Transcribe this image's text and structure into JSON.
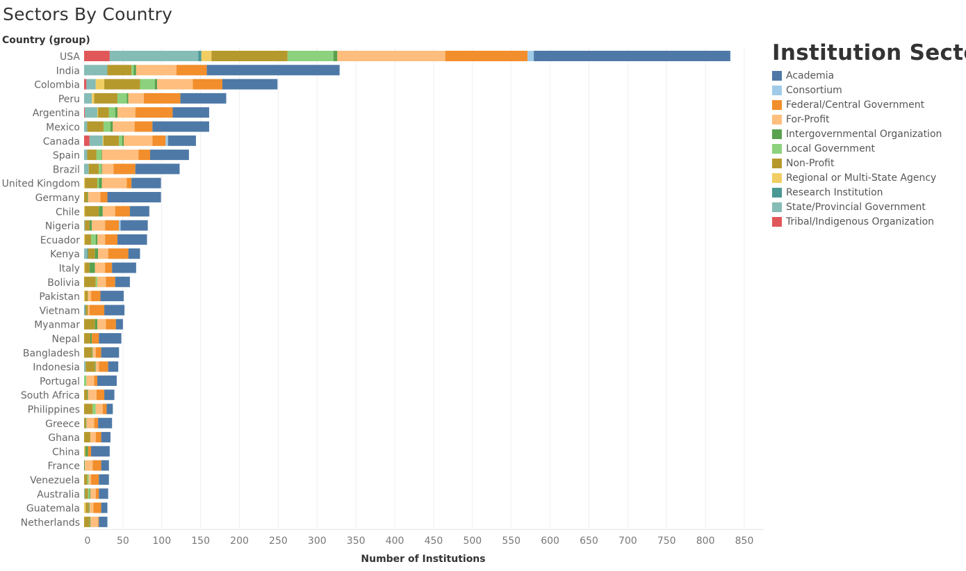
{
  "chart_data": {
    "type": "bar",
    "orientation": "horizontal",
    "stacked": true,
    "title": "Sectors By Country",
    "row_header": "Country (group)",
    "xlabel": "Number of Institutions",
    "ylabel": "Country (group)",
    "xlim": [
      0,
      875
    ],
    "xticks": [
      0,
      50,
      100,
      150,
      200,
      250,
      300,
      350,
      400,
      450,
      500,
      550,
      600,
      650,
      700,
      750,
      800,
      850
    ],
    "grid": true,
    "legend": {
      "title": "Institution Sector",
      "position": "right"
    },
    "stack_order": [
      "Tribal/Indigenous Organization",
      "State/Provincial Government",
      "Research Institution",
      "Regional or Multi-State Agency",
      "Non-Profit",
      "Local Government",
      "Intergovernmental Organization",
      "For-Profit",
      "Federal/Central Government",
      "Consortium",
      "Academia"
    ],
    "categories": [
      "USA",
      "India",
      "Colombia",
      "Peru",
      "Argentina",
      "Mexico",
      "Canada",
      "Spain",
      "Brazil",
      "United Kingdom",
      "Germany",
      "Chile",
      "Nigeria",
      "Ecuador",
      "Kenya",
      "Italy",
      "Bolivia",
      "Pakistan",
      "Vietnam",
      "Myanmar",
      "Nepal",
      "Bangladesh",
      "Indonesia",
      "Portugal",
      "South Africa",
      "Philippines",
      "Greece",
      "Ghana",
      "China",
      "France",
      "Venezuela",
      "Australia",
      "Guatemala",
      "Netherlands"
    ],
    "series": [
      {
        "name": "Academia",
        "color": "#4e79a7",
        "values": [
          253,
          171,
          71,
          59,
          47,
          73,
          36,
          50,
          57,
          38,
          69,
          25,
          35,
          38,
          15,
          31,
          19,
          30,
          26,
          9,
          29,
          23,
          13,
          25,
          13,
          8,
          18,
          12,
          24,
          10,
          13,
          12,
          8,
          11
        ]
      },
      {
        "name": "Consortium",
        "color": "#a0cbe8",
        "values": [
          8,
          0,
          0,
          0,
          0,
          0,
          3,
          0,
          0,
          0,
          0,
          0,
          2,
          0,
          0,
          0,
          0,
          0,
          0,
          0,
          0,
          0,
          0,
          0,
          0,
          0,
          0,
          0,
          0,
          0,
          0,
          0,
          0,
          0
        ]
      },
      {
        "name": "Federal/Central Government",
        "color": "#f28e2b",
        "values": [
          106,
          39,
          38,
          47,
          48,
          23,
          17,
          15,
          28,
          6,
          9,
          19,
          18,
          16,
          26,
          9,
          12,
          12,
          19,
          13,
          9,
          7,
          12,
          4,
          10,
          5,
          5,
          7,
          4,
          11,
          10,
          4,
          10,
          1
        ]
      },
      {
        "name": "For-Profit",
        "color": "#ffbe7d",
        "values": [
          139,
          52,
          46,
          20,
          23,
          28,
          37,
          47,
          15,
          32,
          16,
          16,
          17,
          10,
          13,
          13,
          11,
          4,
          2,
          11,
          0,
          4,
          4,
          10,
          11,
          9,
          10,
          7,
          0,
          10,
          3,
          7,
          5,
          10
        ]
      },
      {
        "name": "Intergovernmental Organization",
        "color": "#59a14f",
        "values": [
          5,
          3,
          3,
          2,
          3,
          3,
          2,
          1,
          1,
          4,
          1,
          5,
          3,
          2,
          4,
          7,
          0,
          0,
          0,
          3,
          2,
          1,
          1,
          0,
          1,
          0,
          1,
          0,
          3,
          1,
          0,
          1,
          1,
          1
        ]
      },
      {
        "name": "Local Government",
        "color": "#8cd17d",
        "values": [
          59,
          3,
          19,
          12,
          8,
          9,
          4,
          6,
          3,
          2,
          0,
          0,
          0,
          6,
          0,
          0,
          2,
          0,
          0,
          0,
          0,
          0,
          0,
          3,
          0,
          4,
          0,
          0,
          0,
          0,
          2,
          2,
          0,
          0
        ]
      },
      {
        "name": "Non-Profit",
        "color": "#b6992d",
        "values": [
          98,
          31,
          46,
          30,
          14,
          21,
          20,
          12,
          13,
          16,
          4,
          18,
          6,
          8,
          9,
          6,
          15,
          4,
          3,
          14,
          8,
          10,
          12,
          0,
          4,
          11,
          2,
          8,
          1,
          0,
          4,
          4,
          4,
          7
        ]
      },
      {
        "name": "Regional or Multi-State Agency",
        "color": "#f1ce63",
        "values": [
          13,
          0,
          11,
          3,
          1,
          0,
          1,
          0,
          0,
          1,
          0,
          1,
          0,
          1,
          0,
          1,
          0,
          1,
          0,
          0,
          0,
          0,
          0,
          0,
          0,
          0,
          0,
          0,
          1,
          0,
          0,
          0,
          2,
          0
        ]
      },
      {
        "name": "Research Institution",
        "color": "#499894",
        "values": [
          4,
          0,
          0,
          0,
          0,
          0,
          0,
          0,
          0,
          0,
          0,
          0,
          0,
          0,
          1,
          0,
          0,
          0,
          1,
          0,
          0,
          0,
          0,
          0,
          0,
          0,
          0,
          0,
          0,
          0,
          0,
          0,
          0,
          0
        ]
      },
      {
        "name": "State/Provincial Government",
        "color": "#86bcb6",
        "values": [
          114,
          30,
          12,
          10,
          16,
          4,
          17,
          4,
          6,
          0,
          0,
          0,
          1,
          0,
          4,
          0,
          0,
          0,
          1,
          0,
          0,
          0,
          2,
          0,
          0,
          0,
          0,
          0,
          0,
          0,
          0,
          1,
          0,
          0
        ]
      },
      {
        "name": "Tribal/Indigenous Organization",
        "color": "#e15759",
        "values": [
          33,
          0,
          3,
          0,
          1,
          0,
          7,
          0,
          0,
          0,
          0,
          0,
          0,
          0,
          0,
          0,
          0,
          0,
          0,
          0,
          0,
          0,
          0,
          0,
          0,
          0,
          0,
          0,
          0,
          0,
          0,
          0,
          0,
          0
        ]
      }
    ]
  }
}
